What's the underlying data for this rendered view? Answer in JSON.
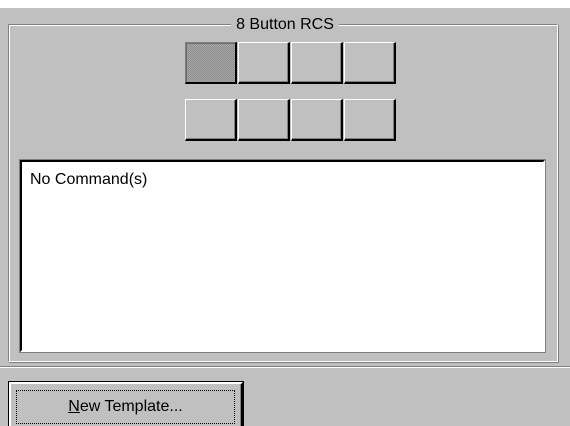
{
  "group": {
    "title": "8 Button RCS"
  },
  "rcs_buttons": {
    "row1": [
      {
        "id": 1,
        "selected": true
      },
      {
        "id": 2,
        "selected": false
      },
      {
        "id": 3,
        "selected": false
      },
      {
        "id": 4,
        "selected": false
      }
    ],
    "row2": [
      {
        "id": 5,
        "selected": false
      },
      {
        "id": 6,
        "selected": false
      },
      {
        "id": 7,
        "selected": false
      },
      {
        "id": 8,
        "selected": false
      }
    ]
  },
  "command_list": {
    "text": "No Command(s)"
  },
  "footer": {
    "new_template_label": "New Template...",
    "new_template_accel": "N",
    "new_template_rest": "ew Template..."
  },
  "colors": {
    "face": "#c0c0c0",
    "shadow": "#808080",
    "highlight": "#ffffff",
    "selected_button": "#9a9a9a"
  }
}
